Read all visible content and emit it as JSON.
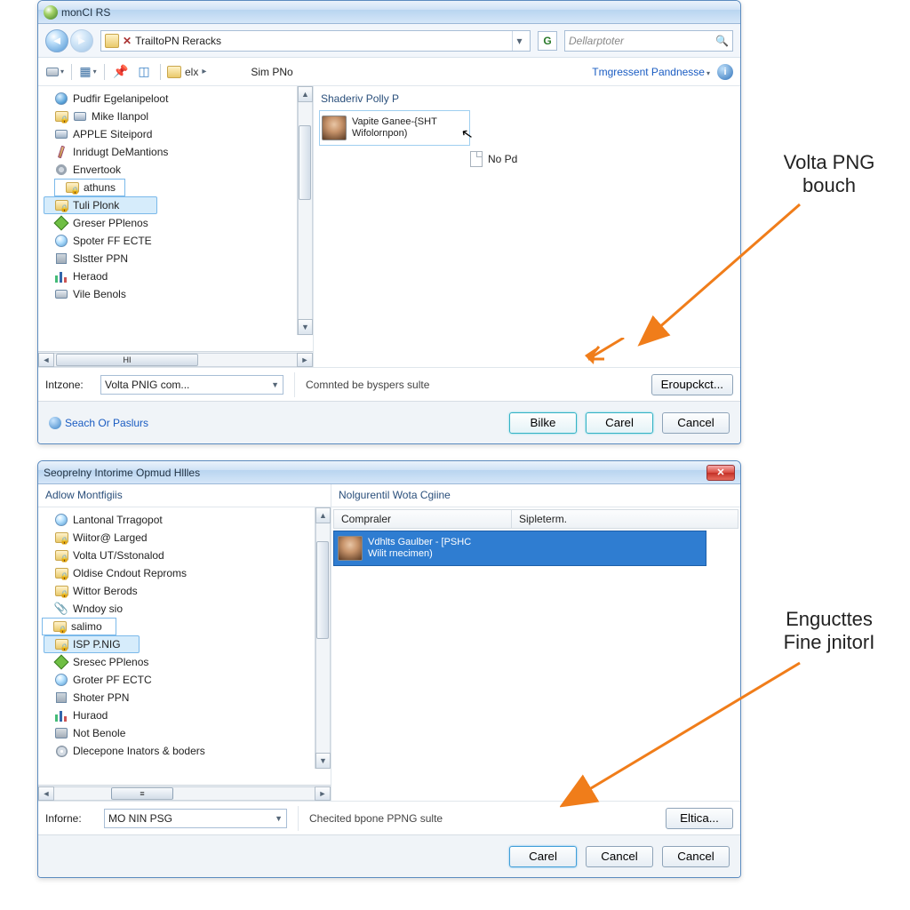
{
  "dialog1": {
    "title": "monCI RS",
    "address_text": "TrailtoPN Reracks",
    "refresh_label": "G",
    "search_placeholder": "Dellarptoter",
    "toolbar": {
      "crumb_folder": "elx",
      "crumb_text": "Sim PNo",
      "right_link": "Tmgressent Pandnesse",
      "help": "i"
    },
    "tree": [
      {
        "icon": "globe",
        "label": "Pudfir Egelanipeloot"
      },
      {
        "icon": "foldlock",
        "label": "Mike Ilanpol",
        "extra": "disk"
      },
      {
        "icon": "disk",
        "label": "APPLE Siteipord"
      },
      {
        "icon": "paint",
        "label": "Inridugt DeMantions"
      },
      {
        "icon": "gear",
        "label": "Envertook"
      },
      {
        "icon": "foldlock",
        "label": "athuns",
        "box": true
      },
      {
        "icon": "foldlock",
        "label": "Tuli Plonk",
        "sel": true
      },
      {
        "icon": "green",
        "label": "Greser PPlenos"
      },
      {
        "icon": "net",
        "label": "Spoter FF ECTE"
      },
      {
        "icon": "one",
        "label": "Slstter PPN"
      },
      {
        "icon": "bar",
        "label": "Heraod"
      },
      {
        "icon": "hdd",
        "label": "Vile Benols"
      }
    ],
    "hscroll_label": "HI",
    "content": {
      "header": "Shaderiv Polly P",
      "item_line1": "Vapite Ganee-{SHT",
      "item_line2": "Wifolornpon)",
      "no_pd": "No Pd"
    },
    "combo": {
      "label": "Intzone:",
      "value": "Volta PNIG com..."
    },
    "status_text": "Comnted be byspers sulte",
    "browse_btn": "Eroupckct...",
    "help_link": "Seach Or Paslurs",
    "footer_buttons": [
      "Bilke",
      "Carel",
      "Cancel"
    ]
  },
  "dialog2": {
    "title": "Seoprelny Intorime Opmud Hllles",
    "left_header": "Adlow Montfigiis",
    "right_header": "Nolgurentil Wota Cgiine",
    "columns": [
      "Compraler",
      "Sipleterm."
    ],
    "row": {
      "line1": "Vdhlts Gaulber - [PSHC",
      "line2": "Wilit rnecimen)"
    },
    "tree": [
      {
        "icon": "net",
        "label": "Lantonal Trragopot"
      },
      {
        "icon": "foldlock",
        "label": "Wiitor@ Larged"
      },
      {
        "icon": "foldlock",
        "label": "Volta UT/Sstonalod"
      },
      {
        "icon": "foldlock",
        "label": "Oldise Cndout Reproms"
      },
      {
        "icon": "foldlock",
        "label": "Wittor Berods"
      },
      {
        "icon": "clip",
        "label": "Wndoy sio"
      },
      {
        "icon": "foldlock",
        "label": "salimo",
        "box": true
      },
      {
        "icon": "foldlock",
        "label": "ISP P.NIG",
        "sel": true
      },
      {
        "icon": "green",
        "label": "Sresec PPlenos"
      },
      {
        "icon": "net",
        "label": "Groter PF ECTC"
      },
      {
        "icon": "one",
        "label": "Shoter PPN"
      },
      {
        "icon": "bar",
        "label": "Huraod"
      },
      {
        "icon": "chip",
        "label": "Not Benole"
      },
      {
        "icon": "cd",
        "label": "Dlecepone Inators & boders"
      }
    ],
    "combo": {
      "label": "Inforne:",
      "value": "MO NIN PSG"
    },
    "status_text": "Checited bpone PPNG sulte",
    "browse_btn": "Eltica...",
    "footer_buttons": [
      "Carel",
      "Cancel",
      "Cancel"
    ]
  },
  "annotations": {
    "a1_l1": "Volta PNG",
    "a1_l2": "bouch",
    "a2_l1": "Engucttes",
    "a2_l2": "Fine jnitorI"
  }
}
